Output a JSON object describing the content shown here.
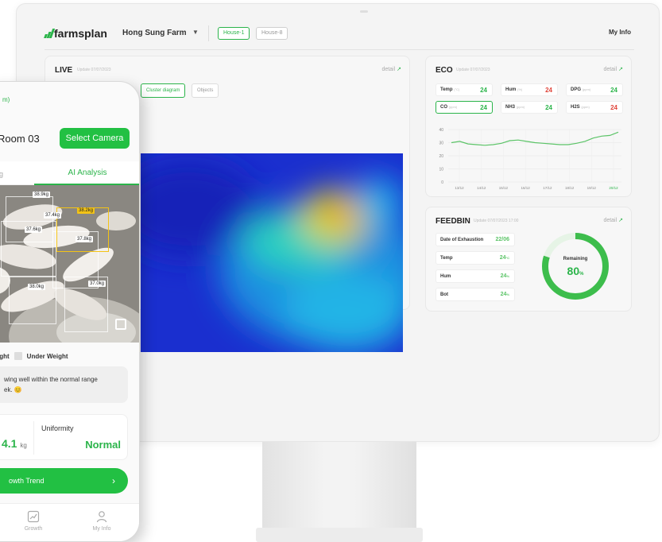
{
  "header": {
    "logo": "farmsplan",
    "farm_name": "Hong Sung Farm",
    "houses": [
      {
        "label": "House-1",
        "active": true
      },
      {
        "label": "House-8",
        "active": false
      }
    ],
    "my_info": "My Info"
  },
  "live": {
    "title": "LIVE",
    "update": "Update 07/07/2023",
    "detail": "detail",
    "tabs": [
      "Cluster diagram",
      "Objects"
    ]
  },
  "eco": {
    "title": "ECO",
    "update": "Update 07/07/2023",
    "detail": "detail",
    "metrics": [
      {
        "key": "Temp",
        "unit": "(°C)",
        "value": "24",
        "color": "#2bb44a",
        "selected": false
      },
      {
        "key": "Hum",
        "unit": "(%)",
        "value": "24",
        "color": "#e0443a",
        "selected": false
      },
      {
        "key": "DPG",
        "unit": "(ppm)",
        "value": "24",
        "color": "#2bb44a",
        "selected": false
      },
      {
        "key": "CO",
        "unit": "(ppm)",
        "value": "24",
        "color": "#2bb44a",
        "selected": true
      },
      {
        "key": "NH3",
        "unit": "(ppm)",
        "value": "24",
        "color": "#2bb44a",
        "selected": false
      },
      {
        "key": "H2S",
        "unit": "(ppm)",
        "value": "24",
        "color": "#e0443a",
        "selected": false
      }
    ]
  },
  "chart_data": {
    "type": "line",
    "y_ticks": [
      "40",
      "30",
      "20",
      "10",
      "0"
    ],
    "ylim": [
      0,
      40
    ],
    "x": [
      "13/12",
      "14/12",
      "15/12",
      "16/12",
      "17/12",
      "18/12",
      "19/12",
      "20/12"
    ],
    "highlight_x": "20/12",
    "series": [
      {
        "values": [
          30,
          31,
          29,
          28.5,
          28,
          28.5,
          29.5,
          31.5,
          32,
          31,
          30,
          29.5,
          29,
          28.5,
          28.5,
          29.5,
          31,
          33.5,
          35,
          35.5,
          38
        ],
        "color": "#5cc468"
      }
    ],
    "grid": true
  },
  "feedbin": {
    "title": "FEEDBIN",
    "update": "Update 07/07/2023 17:00",
    "detail": "detail",
    "rows": [
      {
        "key": "Date of Exhaustion",
        "value": "22/06",
        "unit": ""
      },
      {
        "key": "Temp",
        "value": "24",
        "unit": "°C"
      },
      {
        "key": "Hum",
        "value": "24",
        "unit": "%"
      },
      {
        "key": "Bot",
        "value": "24",
        "unit": "%"
      }
    ],
    "remaining_label": "Remaining",
    "remaining_value": "80",
    "remaining_unit": "%",
    "remaining_fraction": 0.8
  },
  "phone": {
    "crumb": "m)",
    "room": "Room 03",
    "select_camera": "Select Camera",
    "tab_left": "g",
    "tab_ai": "AI Analysis",
    "weights": [
      "38.9kg",
      "37.4kg",
      "38.2kg",
      "37.6kg",
      "37.8kg",
      "38.0kg",
      "37.0kg"
    ],
    "legend_left": "ight",
    "legend_under": "Under Weight",
    "msg_line1": "wing well within the normal range",
    "msg_line2": "ek. 😊",
    "stat_value": "4.1",
    "stat_unit": "kg",
    "uniformity_label": "Uniformity",
    "uniformity_value": "Normal",
    "trend_label": "owth Trend",
    "nav": [
      "Growth",
      "My Info"
    ]
  }
}
